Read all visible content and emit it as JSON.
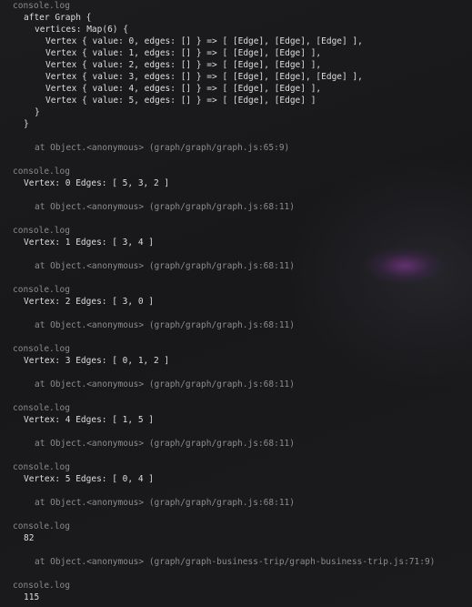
{
  "log_label": "console.log",
  "graph_dump": {
    "title": "after Graph {",
    "vertices_open": "vertices: Map(6) {",
    "rows": [
      "Vertex { value: 0, edges: [] } => [ [Edge], [Edge], [Edge] ],",
      "Vertex { value: 1, edges: [] } => [ [Edge], [Edge] ],",
      "Vertex { value: 2, edges: [] } => [ [Edge], [Edge] ],",
      "Vertex { value: 3, edges: [] } => [ [Edge], [Edge], [Edge] ],",
      "Vertex { value: 4, edges: [] } => [ [Edge], [Edge] ],",
      "Vertex { value: 5, edges: [] } => [ [Edge], [Edge] ]"
    ],
    "vertices_close": "}",
    "close": "}",
    "trace": "at Object.<anonymous> (graph/graph/graph.js:65:9)"
  },
  "vertex_logs": [
    {
      "text": "Vertex: 0 Edges: [ 5, 3, 2 ]",
      "trace": "at Object.<anonymous> (graph/graph/graph.js:68:11)"
    },
    {
      "text": "Vertex: 1 Edges: [ 3, 4 ]",
      "trace": "at Object.<anonymous> (graph/graph/graph.js:68:11)"
    },
    {
      "text": "Vertex: 2 Edges: [ 3, 0 ]",
      "trace": "at Object.<anonymous> (graph/graph/graph.js:68:11)"
    },
    {
      "text": "Vertex: 3 Edges: [ 0, 1, 2 ]",
      "trace": "at Object.<anonymous> (graph/graph/graph.js:68:11)"
    },
    {
      "text": "Vertex: 4 Edges: [ 1, 5 ]",
      "trace": "at Object.<anonymous> (graph/graph/graph.js:68:11)"
    },
    {
      "text": "Vertex: 5 Edges: [ 0, 4 ]",
      "trace": "at Object.<anonymous> (graph/graph/graph.js:68:11)"
    }
  ],
  "trip_log": {
    "value": "82",
    "trace": "at Object.<anonymous> (graph/graph-business-trip/graph-business-trip.js:71:9)"
  },
  "final_log": {
    "value": "115"
  }
}
